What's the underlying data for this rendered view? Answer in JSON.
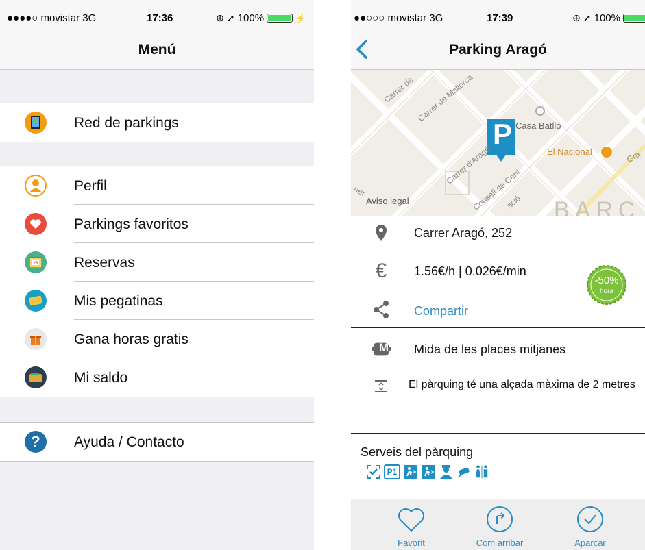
{
  "colors": {
    "accent": "#2a8bc5",
    "parking_blue": "#1e8fc4",
    "badge_green": "#7cc23a",
    "separator": "#c8c7cc",
    "background": "#efeff4"
  },
  "left_screen": {
    "status_bar": {
      "carrier": "●●●●○ movistar  3G",
      "time": "17:36",
      "battery": "100%",
      "battery_level": 1.0
    },
    "title": "Menú",
    "menu_groups": [
      [
        {
          "label": "Red de parkings",
          "icon": "phone-map-icon"
        }
      ],
      [
        {
          "label": "Perfil",
          "icon": "profile-icon"
        },
        {
          "label": "Parkings favoritos",
          "icon": "heart-icon"
        },
        {
          "label": "Reservas",
          "icon": "calendar-icon"
        },
        {
          "label": "Mis pegatinas",
          "icon": "sticker-icon"
        },
        {
          "label": "Gana horas gratis",
          "icon": "gift-icon"
        },
        {
          "label": "Mi saldo",
          "icon": "wallet-icon"
        }
      ],
      [
        {
          "label": "Ayuda / Contacto",
          "icon": "help-icon"
        }
      ]
    ]
  },
  "right_screen": {
    "status_bar": {
      "carrier": "●●○○○ movistar  3G",
      "time": "17:39",
      "battery": "100%",
      "battery_level": 1.0
    },
    "title": "Parking Aragó",
    "map": {
      "streets": [
        "Carrer de",
        "Carrer de Mallorca",
        "Carrer d'Aragó",
        "Consell de Cent",
        "ació",
        "ner"
      ],
      "places": [
        "Casa Batlló",
        "El Nacional",
        "Gra"
      ],
      "district": "BARC",
      "legal_link": "Aviso legal",
      "marker_letter": "P"
    },
    "address": "Carrer Aragó, 252",
    "price": "1.56€/h | 0.026€/min",
    "discount": {
      "value": "-50%",
      "unit": "hora"
    },
    "share": "Compartir",
    "size_info": "Mida de les places mitjanes",
    "height_info": "El pàrquing té una alçada màxima de 2 metres",
    "size_icon_letter": "M",
    "services_title": "Serveis del pàrquing",
    "services": [
      {
        "icon": "check-scan-icon",
        "text": ""
      },
      {
        "icon": "p1-sign-icon",
        "text": "P1"
      },
      {
        "icon": "exit-icon",
        "text": ""
      },
      {
        "icon": "exit-icon",
        "text": ""
      },
      {
        "icon": "security-guard-icon",
        "text": ""
      },
      {
        "icon": "cctv-camera-icon",
        "text": ""
      },
      {
        "icon": "toilets-icon",
        "text": ""
      }
    ],
    "tab_bar": {
      "favorite": "Favorit",
      "directions": "Com arribar",
      "park": "Aparcar"
    }
  }
}
